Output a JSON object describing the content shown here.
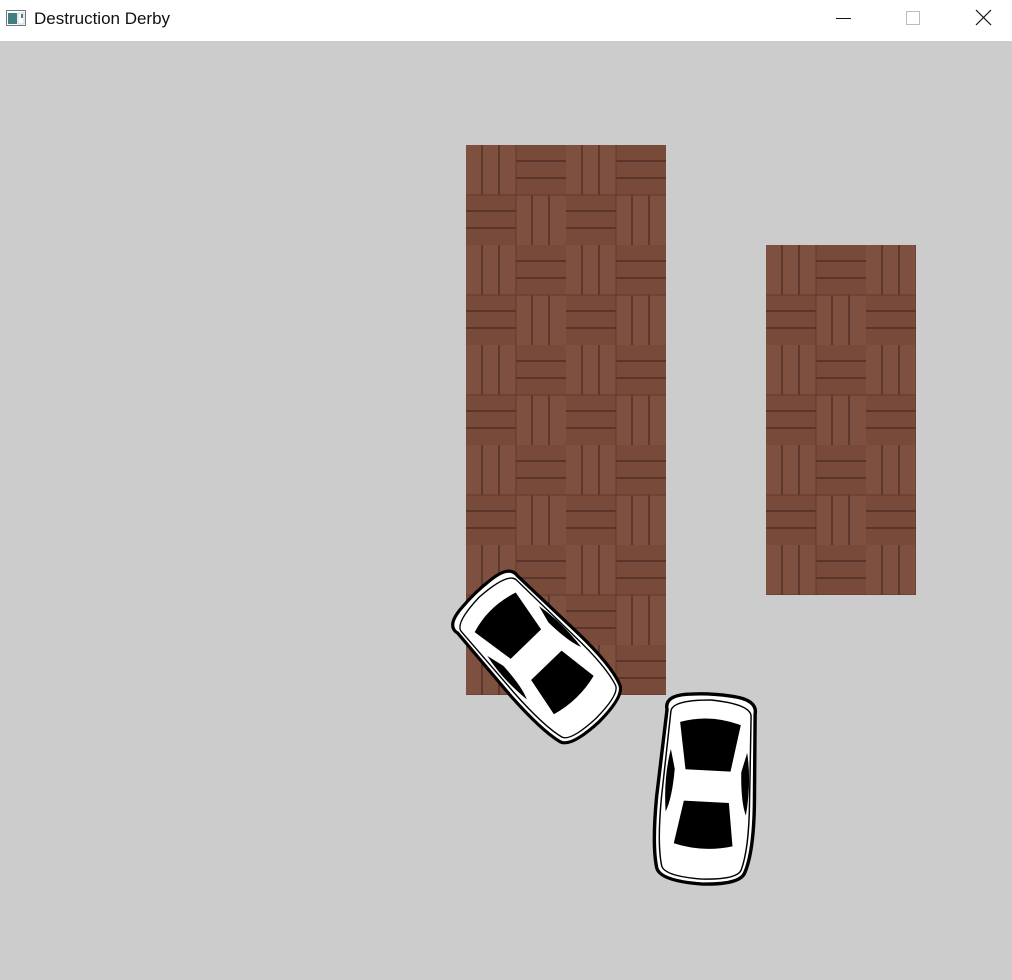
{
  "window": {
    "title": "Destruction Derby",
    "controls": {
      "minimize": "minimize",
      "maximize": "maximize",
      "close": "close"
    }
  },
  "game": {
    "background_color": "#cccccc",
    "obstacles": [
      {
        "name": "wood-crate-tall",
        "texture": "parquet-wood",
        "color": "#7a4e3c"
      },
      {
        "name": "wood-crate-short",
        "texture": "parquet-wood",
        "color": "#7a4e3c"
      }
    ],
    "cars": [
      {
        "name": "car-1",
        "color": "#ffffff",
        "outline": "#000000"
      },
      {
        "name": "car-2",
        "color": "#ffffff",
        "outline": "#000000"
      }
    ]
  }
}
